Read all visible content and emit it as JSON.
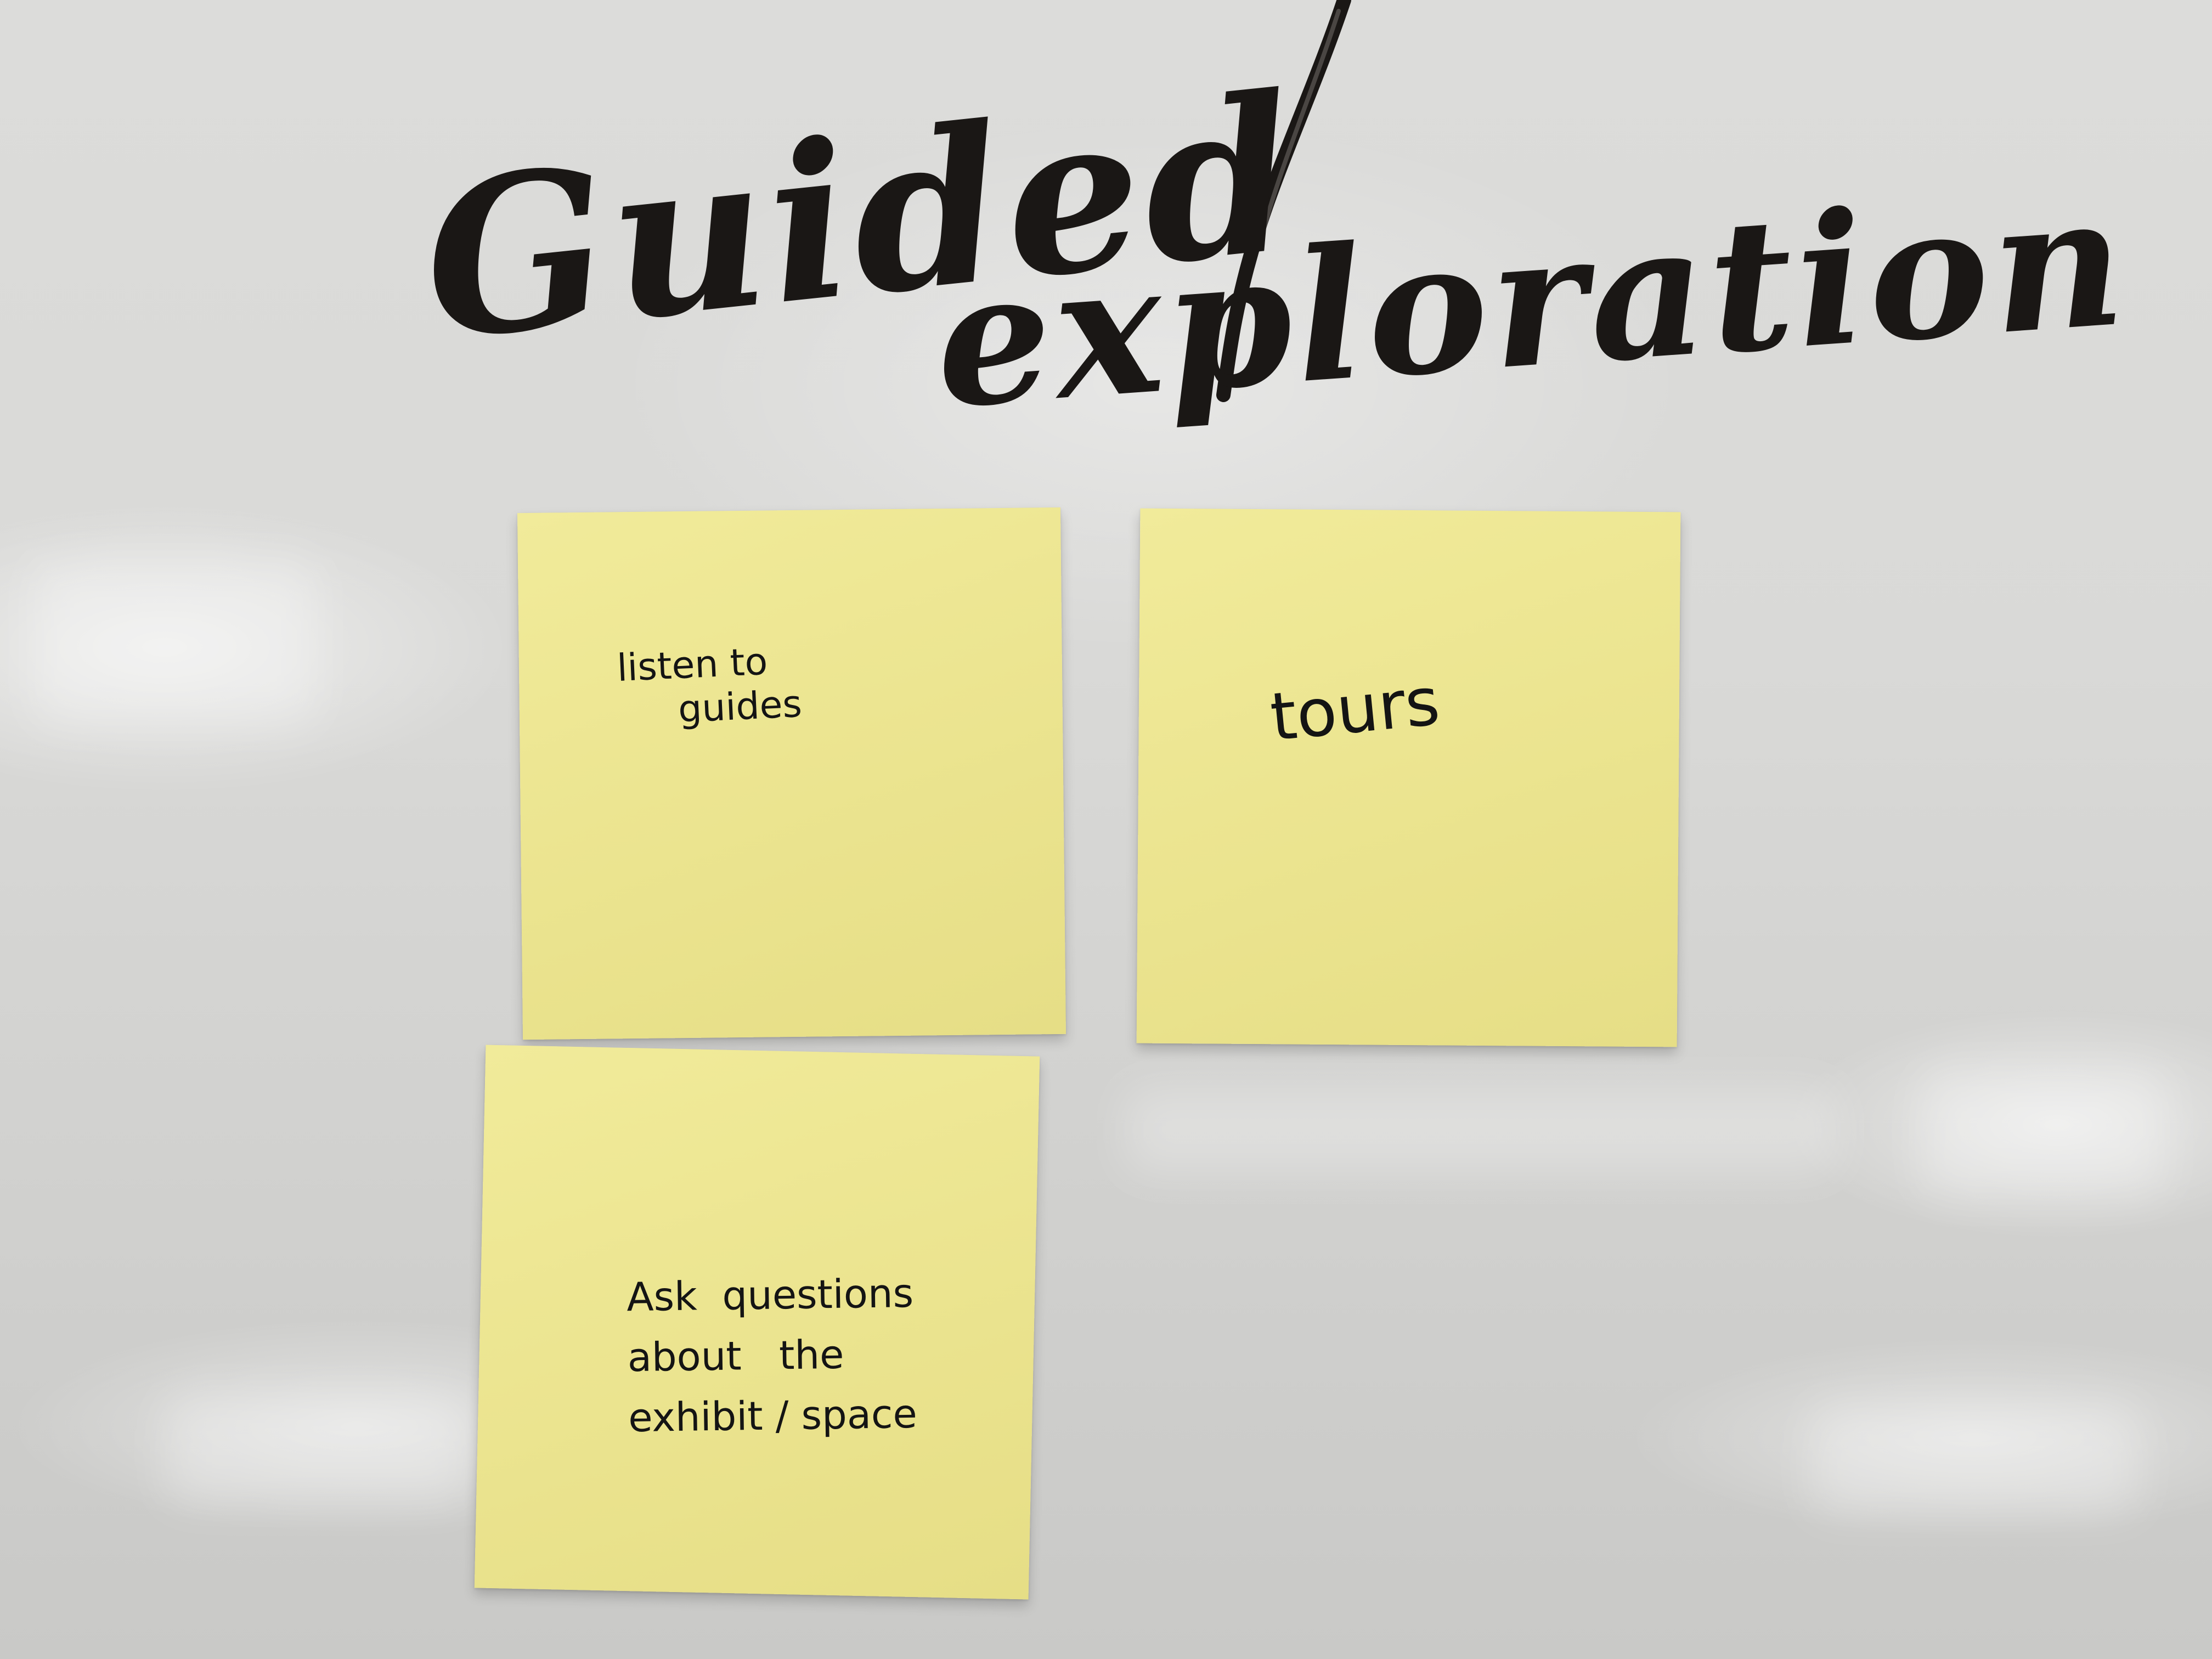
{
  "whiteboard": {
    "heading": {
      "line1": "Guided",
      "line2": "exploration"
    }
  },
  "sticky_notes": [
    {
      "text": "listen to\n     guides"
    },
    {
      "text": "tours"
    },
    {
      "text": "Ask  questions\nabout   the\nexhibit / space"
    }
  ],
  "colors": {
    "board": "#d9d9d7",
    "sticky_note": "#ece591",
    "ink": "#1a1715"
  }
}
